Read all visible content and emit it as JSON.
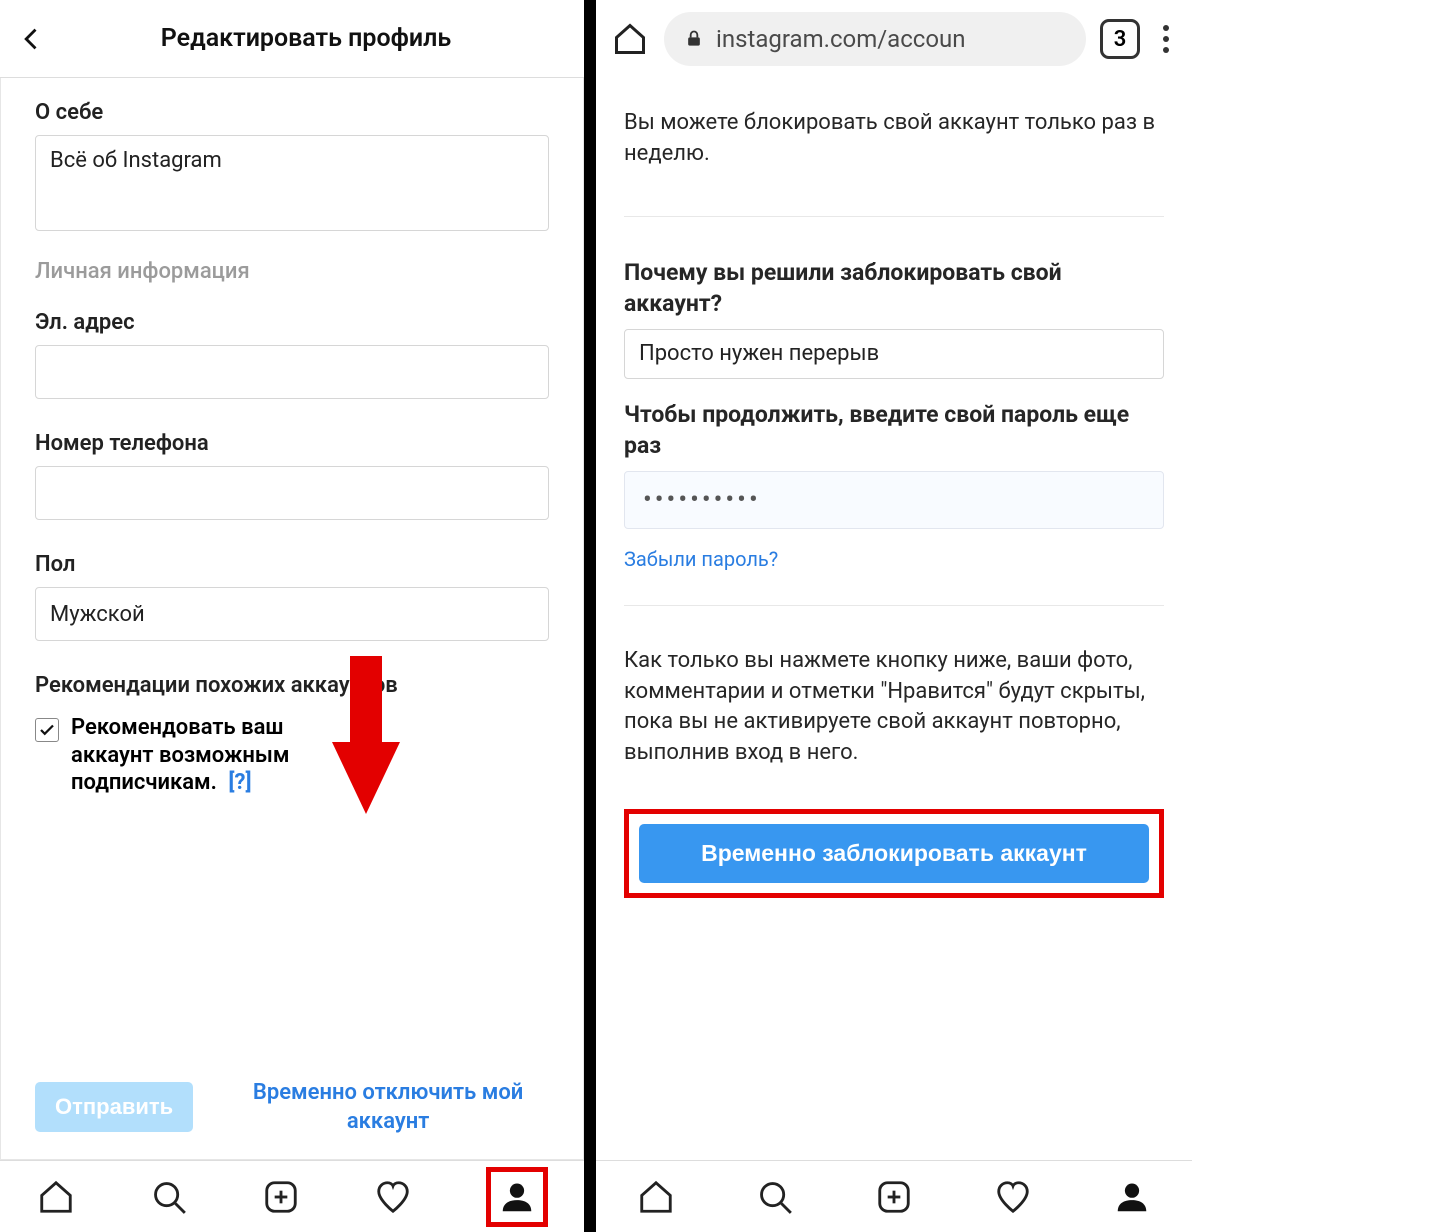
{
  "left": {
    "title": "Редактировать профиль",
    "about_label": "О себе",
    "about_value": "Всё об Instagram",
    "personal_info": "Личная информация",
    "email_label": "Эл. адрес",
    "email_value": "",
    "phone_label": "Номер телефона",
    "phone_value": "",
    "gender_label": "Пол",
    "gender_value": "Мужской",
    "similar_label": "Рекомендации похожих аккаунтов",
    "recommend_text": "Рекомендовать ваш аккаунт возможным подписчикам.",
    "help_link": "[?]",
    "submit_label": "Отправить",
    "disable_link": "Временно отключить мой аккаунт"
  },
  "right": {
    "url_display": "instagram.com/accoun",
    "tabs_count": "3",
    "notice": "Вы можете блокировать свой аккаунт только раз в неделю.",
    "reason_label": "Почему вы решили заблокировать свой аккаунт?",
    "reason_value": "Просто нужен перерыв",
    "password_label": "Чтобы продолжить, введите свой пароль еще раз",
    "password_masked": "••••••••••",
    "forgot_label": "Забыли пароль?",
    "consequence": "Как только вы нажмете кнопку ниже, ваши фото, комментарии и отметки \"Нравится\" будут скрыты, пока вы не активируете свой аккаунт повторно, выполнив вход в него.",
    "block_button": "Временно заблокировать аккаунт"
  }
}
